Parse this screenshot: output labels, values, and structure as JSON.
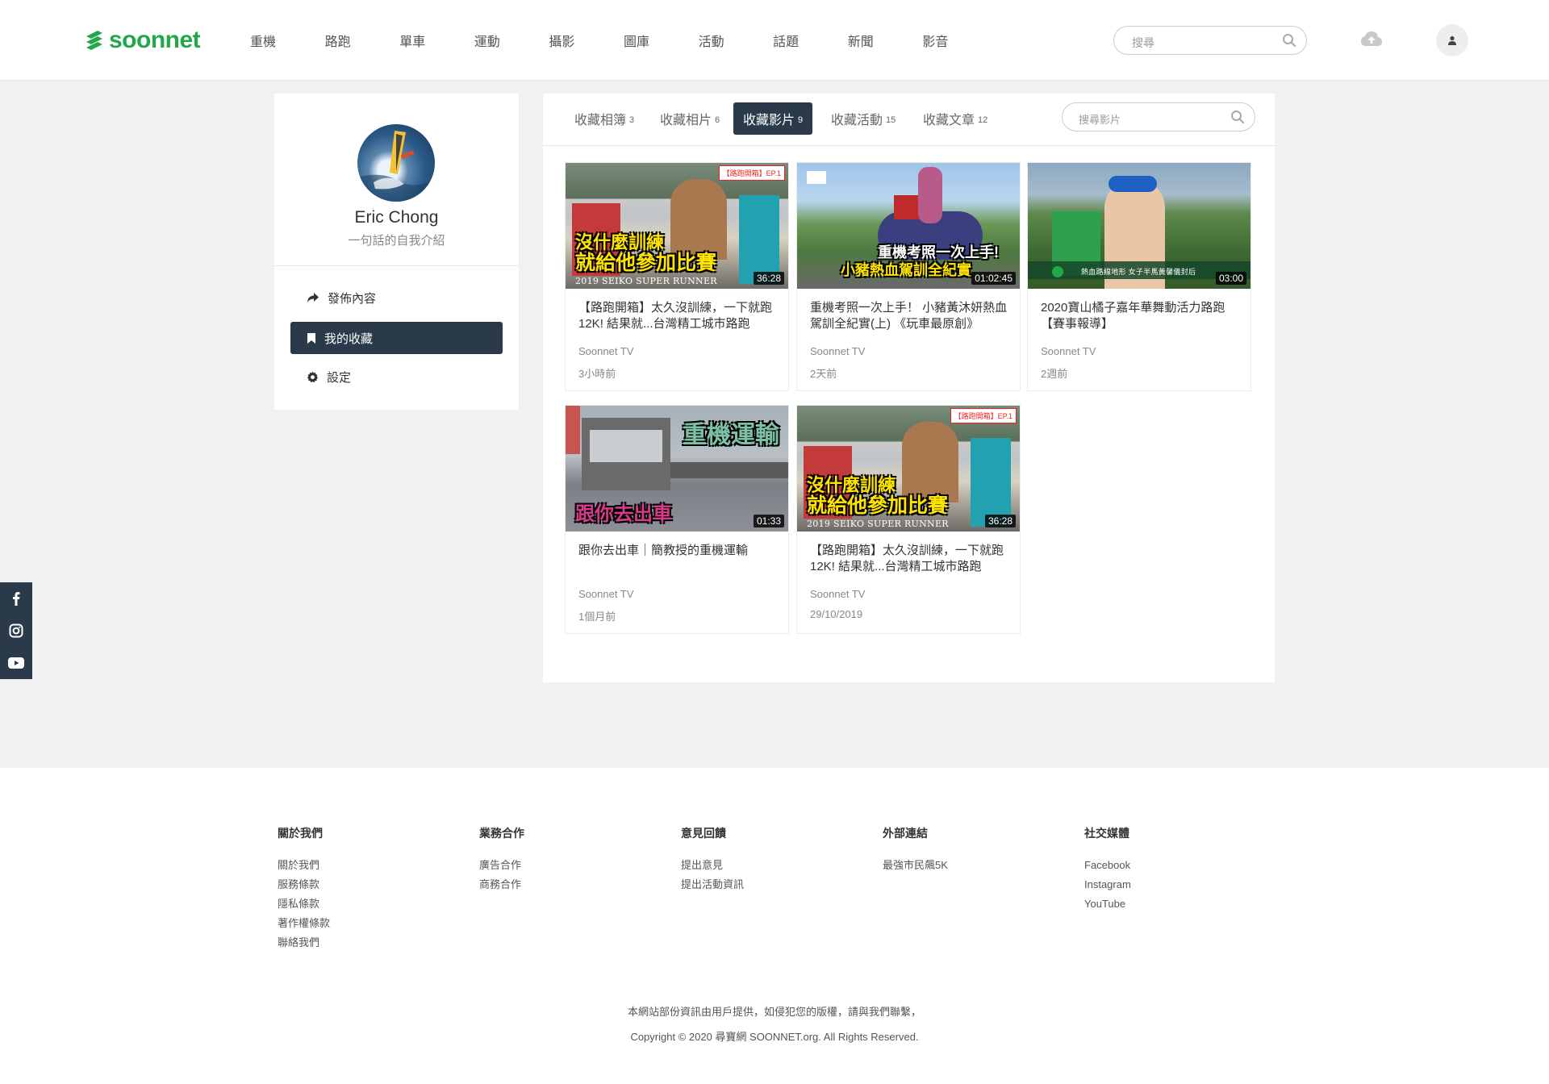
{
  "header": {
    "logo": "soonnet",
    "nav": [
      "重機",
      "路跑",
      "單車",
      "運動",
      "攝影",
      "圖庫",
      "活動",
      "話題",
      "新聞",
      "影音"
    ],
    "search_placeholder": "搜尋"
  },
  "profile": {
    "name": "Eric Chong",
    "bio": "一句話的自我介紹",
    "menu": [
      {
        "label": "發佈內容",
        "icon": "share-icon"
      },
      {
        "label": "我的收藏",
        "icon": "bookmark-icon"
      },
      {
        "label": "設定",
        "icon": "gear-icon"
      }
    ]
  },
  "tabs": [
    {
      "label": "收藏相簿",
      "count": "3"
    },
    {
      "label": "收藏相片",
      "count": "6"
    },
    {
      "label": "收藏影片",
      "count": "9"
    },
    {
      "label": "收藏活動",
      "count": "15"
    },
    {
      "label": "收藏文章",
      "count": "12"
    }
  ],
  "video_search_placeholder": "搜尋影片",
  "videos": [
    {
      "title": "【路跑開箱】太久沒訓練，一下就跑12K! 結果就...台灣精工城市路跑",
      "source": "Soonnet TV",
      "date": "3小時前",
      "duration": "36:28",
      "overlay": [
        "沒什麼訓練",
        "就給他參加比賽"
      ],
      "overlay_small": "2019 SEIKO SUPER RUNNER",
      "overlay_tag": "【路跑開箱】EP.1"
    },
    {
      "title": "重機考照一次上手！ 小豬黃沐妍熱血駕訓全紀實(上) 《玩車最原創》",
      "source": "Soonnet TV",
      "date": "2天前",
      "duration": "01:02:45",
      "overlay": [
        "重機考照一次上手!",
        "小豬熱血駕訓全紀實"
      ],
      "overlay_small": "",
      "overlay_tag": ""
    },
    {
      "title": "2020寶山橘子嘉年華舞動活力路跑【賽事報導】",
      "source": "Soonnet TV",
      "date": "2週前",
      "duration": "03:00",
      "overlay": [],
      "overlay_small": "熱血路線地形 女子半馬黃馨儀封后",
      "overlay_tag": ""
    },
    {
      "title": "跟你去出車｜簡教授的重機運輸",
      "source": "Soonnet TV",
      "date": "1個月前",
      "duration": "01:33",
      "overlay": [
        "重機運輸",
        "跟你去出車"
      ],
      "overlay_small": "",
      "overlay_tag": ""
    },
    {
      "title": "【路跑開箱】太久沒訓練，一下就跑12K! 結果就...台灣精工城市路跑",
      "source": "Soonnet TV",
      "date": "29/10/2019",
      "duration": "36:28",
      "overlay": [
        "沒什麼訓練",
        "就給他參加比賽"
      ],
      "overlay_small": "2019 SEIKO SUPER RUNNER",
      "overlay_tag": "【路跑開箱】EP.1"
    }
  ],
  "social_sidebar": [
    "facebook-icon",
    "instagram-icon",
    "youtube-icon"
  ],
  "footer": {
    "columns": [
      {
        "title": "關於我們",
        "links": [
          "關於我們",
          "服務條款",
          "隱私條款",
          "著作權條款",
          "聯絡我們"
        ]
      },
      {
        "title": "業務合作",
        "links": [
          "廣告合作",
          "商務合作"
        ]
      },
      {
        "title": "意見回饋",
        "links": [
          "提出意見",
          "提出活動資訊"
        ]
      },
      {
        "title": "外部連結",
        "links": [
          "最強市民飆5K"
        ]
      },
      {
        "title": "社交媒體",
        "links": [
          "Facebook",
          "Instagram",
          "YouTube"
        ]
      }
    ],
    "notice": "本網站部份資訊由用戶提供，如侵犯您的版權，請與我們聯繫，",
    "copyright": "Copyright © 2020 尋寶網 SOONNET.org. All Rights Reserved."
  },
  "colors": {
    "brand": "#22a84b",
    "active": "#2a3a4a"
  }
}
